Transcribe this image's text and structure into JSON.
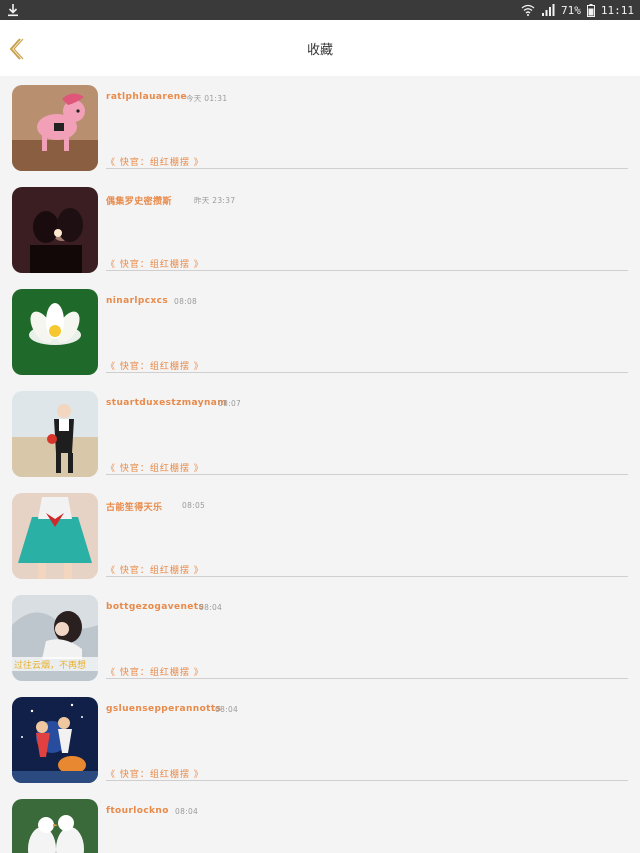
{
  "status_bar": {
    "battery_percent": "71%",
    "time": "11:11",
    "icons": [
      "download-icon",
      "wifi-icon",
      "signal-icon",
      "battery-icon"
    ]
  },
  "header": {
    "title": "收藏",
    "back_icon": "chevron-left-icon",
    "accent": "#c8a24a"
  },
  "colors": {
    "name": "#e88a4a",
    "time": "#9a9a9a",
    "divider": "#cfcfcf",
    "background": "#f4f4f4"
  },
  "favorites": [
    {
      "name": "ratlphlauarene",
      "time": "今天 01:31",
      "source": "《 快官：组红棚摆 》",
      "avatar": "pink-unicorn-toy"
    },
    {
      "name": "偶集罗史密攒斯",
      "time": "昨天 23:37",
      "source": "《 快官：组红棚摆 》",
      "avatar": "couple-kiss"
    },
    {
      "name": "ninarlpcxcs",
      "time": "08:08",
      "source": "《 快官：组红棚摆 》",
      "avatar": "white-lotus"
    },
    {
      "name": "stuartduxestzmaynam",
      "time": "08:07",
      "source": "《 快官：组红棚摆 》",
      "avatar": "girl-beach"
    },
    {
      "name": "古能笙得天乐",
      "time": "08:05",
      "source": "《 快官：组红棚摆 》",
      "avatar": "anime-girl"
    },
    {
      "name": "bottgezogavenets",
      "time": "08:04",
      "source": "《 快官：组红棚摆 》",
      "avatar": "girl-smoke",
      "avatar_caption": "过往云烟，不再想"
    },
    {
      "name": "gsluensepperannotts",
      "time": "08:04",
      "source": "《 快官：组红棚摆 》",
      "avatar": "space-couple"
    },
    {
      "name": "ftourlockno",
      "time": "08:04",
      "source": "",
      "avatar": "white-doves"
    }
  ]
}
